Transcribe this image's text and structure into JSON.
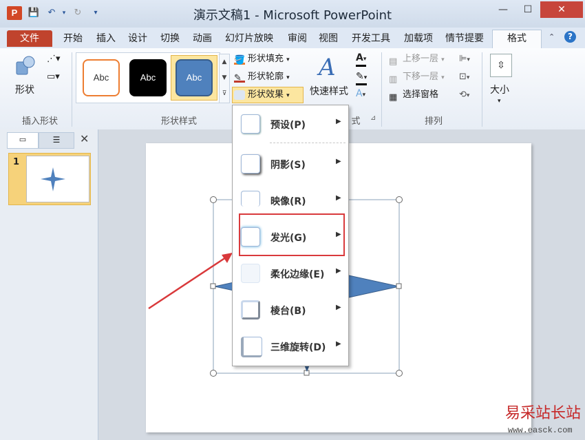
{
  "app": {
    "title": "演示文稿1 - Microsoft PowerPoint",
    "icon_letter": "P",
    "window_buttons": {
      "minimize": "—",
      "restore": "☐",
      "close": "✕"
    }
  },
  "tabs": [
    {
      "label": "文件"
    },
    {
      "label": "开始"
    },
    {
      "label": "插入"
    },
    {
      "label": "设计"
    },
    {
      "label": "切换"
    },
    {
      "label": "动画"
    },
    {
      "label": "幻灯片放映"
    },
    {
      "label": "审阅"
    },
    {
      "label": "视图"
    },
    {
      "label": "开发工具"
    },
    {
      "label": "加载项"
    },
    {
      "label": "情节提要"
    },
    {
      "label": "格式"
    }
  ],
  "ribbon": {
    "insert_shapes": {
      "shapes_label": "形状",
      "group_label": "插入形状"
    },
    "shape_styles": {
      "group_label": "形状样式",
      "gallery": [
        {
          "label": "Abc",
          "fill": "#ffffff",
          "border": "#ed7d31",
          "text": "#333333"
        },
        {
          "label": "Abc",
          "fill": "#000000",
          "border": "#000000",
          "text": "#ffffff"
        },
        {
          "label": "Abc",
          "fill": "#4f81bd",
          "border": "#385d8a",
          "text": "#ffffff"
        }
      ],
      "fill_label": "形状填充",
      "outline_label": "形状轮廓",
      "effects_label": "形状效果"
    },
    "wordart": {
      "quick_styles_label": "快速样式",
      "group_label_partial": "式"
    },
    "arrange": {
      "group_label": "排列",
      "bring_forward": "上移一层",
      "send_backward": "下移一层",
      "selection_pane": "选择窗格"
    },
    "size": {
      "label": "大小"
    }
  },
  "slides_pane": {
    "slide_number": "1"
  },
  "effects_menu": [
    {
      "label": "预设(P)"
    },
    {
      "label": "阴影(S)"
    },
    {
      "label": "映像(R)"
    },
    {
      "label": "发光(G)"
    },
    {
      "label": "柔化边缘(E)"
    },
    {
      "label": "棱台(B)"
    },
    {
      "label": "三维旋转(D)"
    }
  ],
  "watermark": {
    "logo": "易采站长站",
    "url": "www.easck.com"
  },
  "colors": {
    "shape_fill": "#4f81bd",
    "file_tab": "#c0432d",
    "highlight": "#d9393b"
  }
}
